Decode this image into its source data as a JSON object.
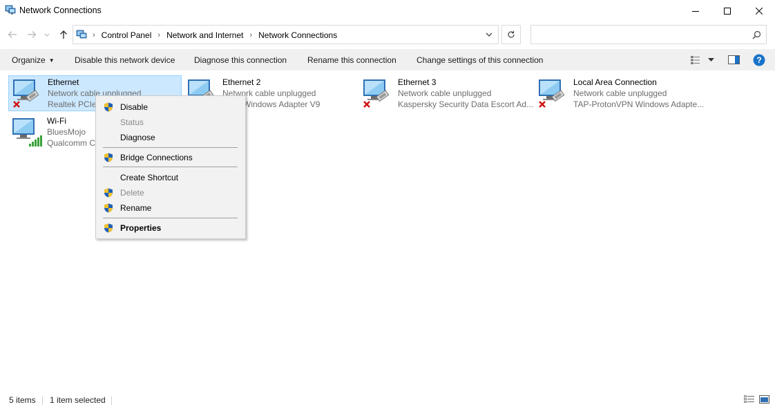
{
  "window": {
    "title": "Network Connections"
  },
  "address": {
    "crumbs": [
      "Control Panel",
      "Network and Internet",
      "Network Connections"
    ],
    "search_placeholder": ""
  },
  "commands": {
    "organize": "Organize",
    "disable": "Disable this network device",
    "diagnose": "Diagnose this connection",
    "rename": "Rename this connection",
    "change_settings": "Change settings of this connection"
  },
  "connections": [
    {
      "name": "Ethernet",
      "status": "Network cable unplugged",
      "device": "Realtek PCIe",
      "state": "disconnected",
      "selected": true
    },
    {
      "name": "Ethernet 2",
      "status": "Network cable unplugged",
      "device": "Windows Adapter V9",
      "state": "disconnected",
      "selected": false
    },
    {
      "name": "Ethernet 3",
      "status": "Network cable unplugged",
      "device": "Kaspersky Security Data Escort Ad...",
      "state": "disconnected",
      "selected": false
    },
    {
      "name": "Local Area Connection",
      "status": "Network cable unplugged",
      "device": "TAP-ProtonVPN Windows Adapte...",
      "state": "disconnected",
      "selected": false
    },
    {
      "name": "Wi-Fi",
      "status": "BluesMojo",
      "device": "Qualcomm C",
      "state": "wifi-connected",
      "selected": false
    }
  ],
  "context_menu": {
    "items": [
      {
        "label": "Disable",
        "shield": true,
        "enabled": true,
        "bold": false
      },
      {
        "label": "Status",
        "shield": false,
        "enabled": false,
        "bold": false
      },
      {
        "label": "Diagnose",
        "shield": false,
        "enabled": true,
        "bold": false
      },
      {
        "label": "Bridge Connections",
        "shield": true,
        "enabled": true,
        "bold": false
      },
      {
        "label": "Create Shortcut",
        "shield": false,
        "enabled": true,
        "bold": false
      },
      {
        "label": "Delete",
        "shield": true,
        "enabled": false,
        "bold": false
      },
      {
        "label": "Rename",
        "shield": true,
        "enabled": true,
        "bold": false
      },
      {
        "label": "Properties",
        "shield": true,
        "enabled": true,
        "bold": true
      }
    ]
  },
  "statusbar": {
    "count": "5 items",
    "selection": "1 item selected"
  },
  "colors": {
    "selection_bg": "#cce8ff",
    "selection_border": "#99d1ff",
    "help_blue": "#1a73c8",
    "error_red": "#d11414",
    "wifi_green": "#3aa23a"
  }
}
